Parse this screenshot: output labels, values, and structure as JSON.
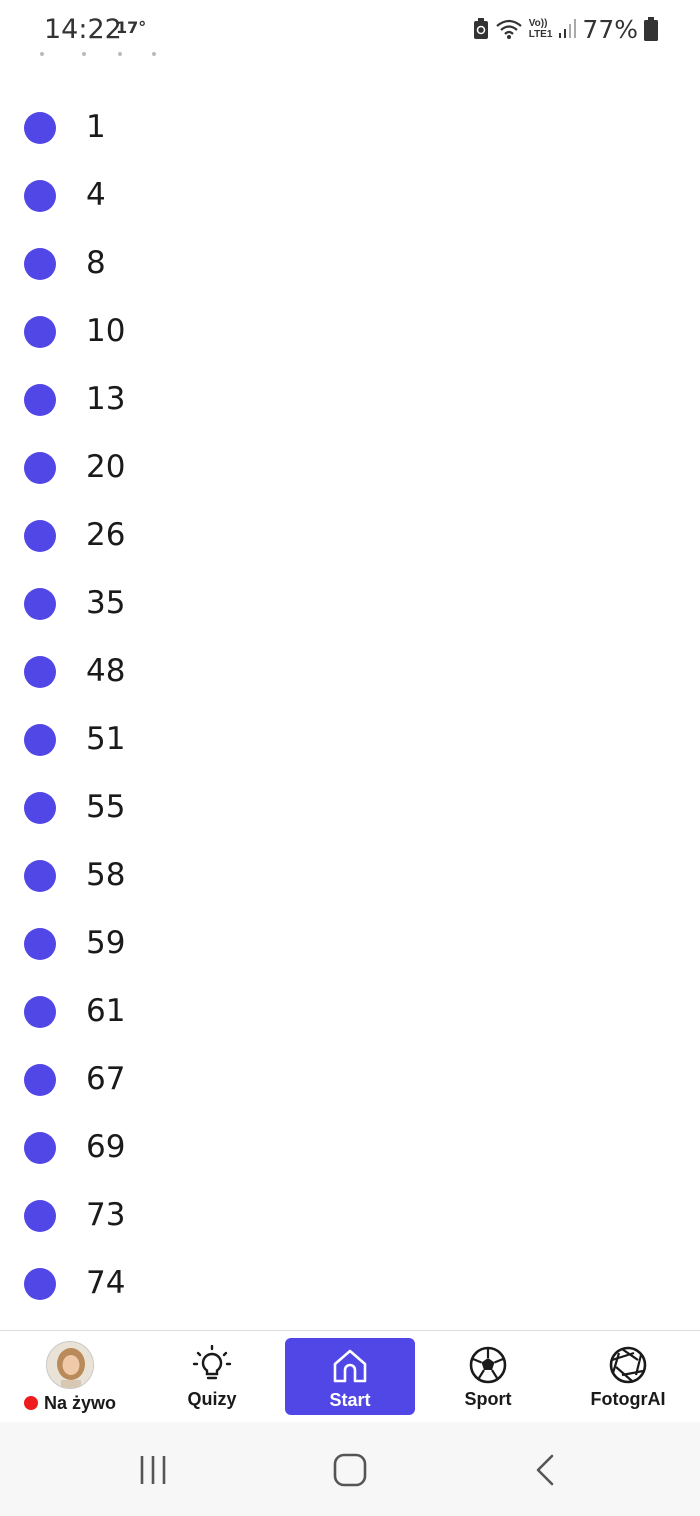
{
  "status_bar": {
    "time": "14:22",
    "temperature": "17°",
    "battery_percent": "77%",
    "network_label_top": "Vo))",
    "network_label_bottom": "LTE1"
  },
  "list": {
    "items": [
      {
        "label": "1"
      },
      {
        "label": "4"
      },
      {
        "label": "8"
      },
      {
        "label": "10"
      },
      {
        "label": "13"
      },
      {
        "label": "20"
      },
      {
        "label": "26"
      },
      {
        "label": "35"
      },
      {
        "label": "48"
      },
      {
        "label": "51"
      },
      {
        "label": "55"
      },
      {
        "label": "58"
      },
      {
        "label": "59"
      },
      {
        "label": "61"
      },
      {
        "label": "67"
      },
      {
        "label": "69"
      },
      {
        "label": "73"
      },
      {
        "label": "74"
      }
    ],
    "bullet_color": "#5147e6"
  },
  "bottom_nav": {
    "items": [
      {
        "label": "Na żywo",
        "icon": "avatar-live"
      },
      {
        "label": "Quizy",
        "icon": "lightbulb-icon"
      },
      {
        "label": "Start",
        "icon": "home-icon",
        "active": true
      },
      {
        "label": "Sport",
        "icon": "soccer-ball-icon"
      },
      {
        "label": "FotogrAI",
        "icon": "camera-aperture-icon"
      }
    ],
    "accent_color": "#5147e6",
    "live_dot_color": "#ee1c1c"
  },
  "system_nav": {
    "buttons": [
      "recent-apps-icon",
      "home-button-icon",
      "back-icon"
    ]
  }
}
